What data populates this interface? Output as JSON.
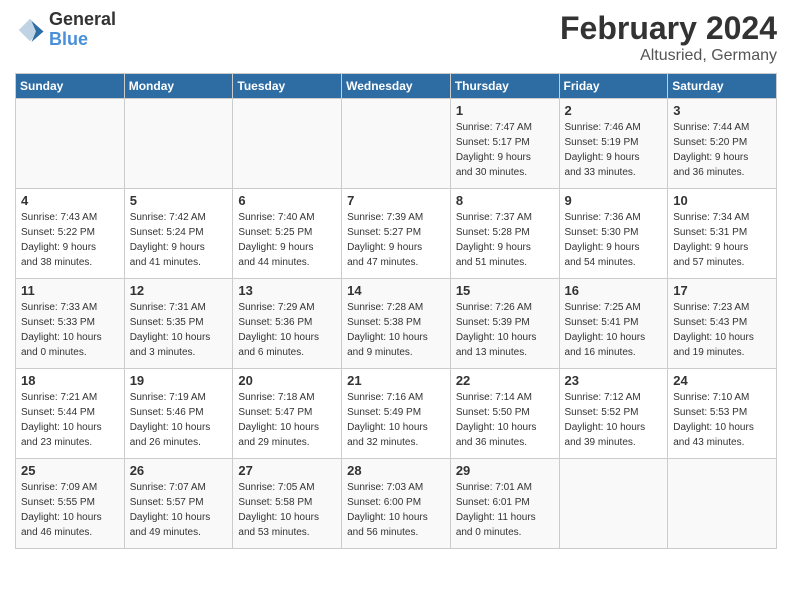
{
  "header": {
    "logo": {
      "general": "General",
      "blue": "Blue"
    },
    "title": "February 2024",
    "location": "Altusried, Germany"
  },
  "weekdays": [
    "Sunday",
    "Monday",
    "Tuesday",
    "Wednesday",
    "Thursday",
    "Friday",
    "Saturday"
  ],
  "weeks": [
    [
      {
        "day": "",
        "info": ""
      },
      {
        "day": "",
        "info": ""
      },
      {
        "day": "",
        "info": ""
      },
      {
        "day": "",
        "info": ""
      },
      {
        "day": "1",
        "info": "Sunrise: 7:47 AM\nSunset: 5:17 PM\nDaylight: 9 hours\nand 30 minutes."
      },
      {
        "day": "2",
        "info": "Sunrise: 7:46 AM\nSunset: 5:19 PM\nDaylight: 9 hours\nand 33 minutes."
      },
      {
        "day": "3",
        "info": "Sunrise: 7:44 AM\nSunset: 5:20 PM\nDaylight: 9 hours\nand 36 minutes."
      }
    ],
    [
      {
        "day": "4",
        "info": "Sunrise: 7:43 AM\nSunset: 5:22 PM\nDaylight: 9 hours\nand 38 minutes."
      },
      {
        "day": "5",
        "info": "Sunrise: 7:42 AM\nSunset: 5:24 PM\nDaylight: 9 hours\nand 41 minutes."
      },
      {
        "day": "6",
        "info": "Sunrise: 7:40 AM\nSunset: 5:25 PM\nDaylight: 9 hours\nand 44 minutes."
      },
      {
        "day": "7",
        "info": "Sunrise: 7:39 AM\nSunset: 5:27 PM\nDaylight: 9 hours\nand 47 minutes."
      },
      {
        "day": "8",
        "info": "Sunrise: 7:37 AM\nSunset: 5:28 PM\nDaylight: 9 hours\nand 51 minutes."
      },
      {
        "day": "9",
        "info": "Sunrise: 7:36 AM\nSunset: 5:30 PM\nDaylight: 9 hours\nand 54 minutes."
      },
      {
        "day": "10",
        "info": "Sunrise: 7:34 AM\nSunset: 5:31 PM\nDaylight: 9 hours\nand 57 minutes."
      }
    ],
    [
      {
        "day": "11",
        "info": "Sunrise: 7:33 AM\nSunset: 5:33 PM\nDaylight: 10 hours\nand 0 minutes."
      },
      {
        "day": "12",
        "info": "Sunrise: 7:31 AM\nSunset: 5:35 PM\nDaylight: 10 hours\nand 3 minutes."
      },
      {
        "day": "13",
        "info": "Sunrise: 7:29 AM\nSunset: 5:36 PM\nDaylight: 10 hours\nand 6 minutes."
      },
      {
        "day": "14",
        "info": "Sunrise: 7:28 AM\nSunset: 5:38 PM\nDaylight: 10 hours\nand 9 minutes."
      },
      {
        "day": "15",
        "info": "Sunrise: 7:26 AM\nSunset: 5:39 PM\nDaylight: 10 hours\nand 13 minutes."
      },
      {
        "day": "16",
        "info": "Sunrise: 7:25 AM\nSunset: 5:41 PM\nDaylight: 10 hours\nand 16 minutes."
      },
      {
        "day": "17",
        "info": "Sunrise: 7:23 AM\nSunset: 5:43 PM\nDaylight: 10 hours\nand 19 minutes."
      }
    ],
    [
      {
        "day": "18",
        "info": "Sunrise: 7:21 AM\nSunset: 5:44 PM\nDaylight: 10 hours\nand 23 minutes."
      },
      {
        "day": "19",
        "info": "Sunrise: 7:19 AM\nSunset: 5:46 PM\nDaylight: 10 hours\nand 26 minutes."
      },
      {
        "day": "20",
        "info": "Sunrise: 7:18 AM\nSunset: 5:47 PM\nDaylight: 10 hours\nand 29 minutes."
      },
      {
        "day": "21",
        "info": "Sunrise: 7:16 AM\nSunset: 5:49 PM\nDaylight: 10 hours\nand 32 minutes."
      },
      {
        "day": "22",
        "info": "Sunrise: 7:14 AM\nSunset: 5:50 PM\nDaylight: 10 hours\nand 36 minutes."
      },
      {
        "day": "23",
        "info": "Sunrise: 7:12 AM\nSunset: 5:52 PM\nDaylight: 10 hours\nand 39 minutes."
      },
      {
        "day": "24",
        "info": "Sunrise: 7:10 AM\nSunset: 5:53 PM\nDaylight: 10 hours\nand 43 minutes."
      }
    ],
    [
      {
        "day": "25",
        "info": "Sunrise: 7:09 AM\nSunset: 5:55 PM\nDaylight: 10 hours\nand 46 minutes."
      },
      {
        "day": "26",
        "info": "Sunrise: 7:07 AM\nSunset: 5:57 PM\nDaylight: 10 hours\nand 49 minutes."
      },
      {
        "day": "27",
        "info": "Sunrise: 7:05 AM\nSunset: 5:58 PM\nDaylight: 10 hours\nand 53 minutes."
      },
      {
        "day": "28",
        "info": "Sunrise: 7:03 AM\nSunset: 6:00 PM\nDaylight: 10 hours\nand 56 minutes."
      },
      {
        "day": "29",
        "info": "Sunrise: 7:01 AM\nSunset: 6:01 PM\nDaylight: 11 hours\nand 0 minutes."
      },
      {
        "day": "",
        "info": ""
      },
      {
        "day": "",
        "info": ""
      }
    ]
  ]
}
